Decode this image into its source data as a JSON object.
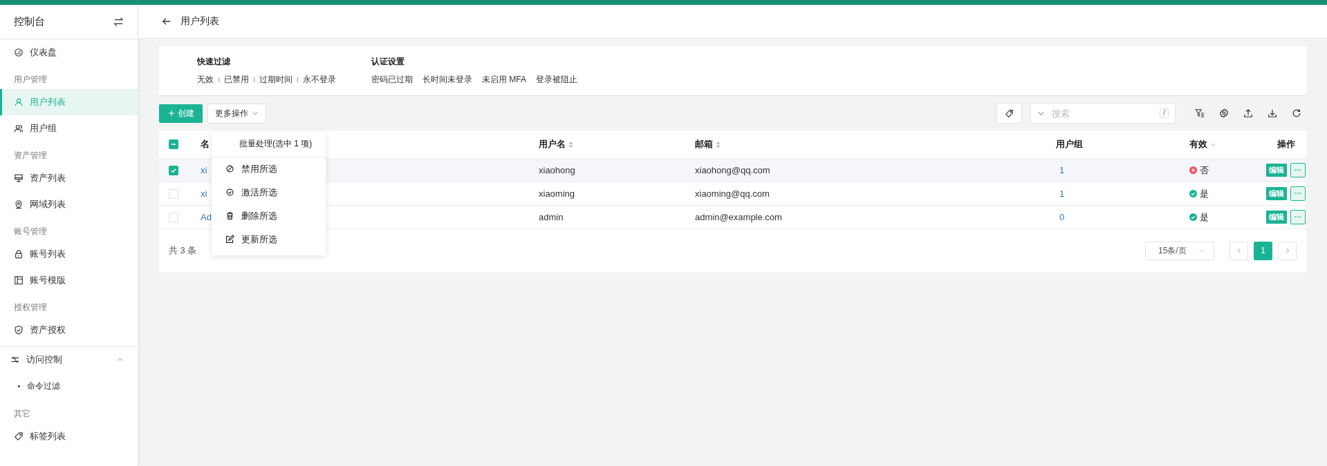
{
  "sidebar": {
    "title": "控制台",
    "items": [
      {
        "kind": "item",
        "label": "仪表盘",
        "selected": false
      },
      {
        "kind": "heading",
        "label": "用户管理"
      },
      {
        "kind": "item",
        "label": "用户列表",
        "selected": true
      },
      {
        "kind": "item",
        "label": "用户组",
        "selected": false
      },
      {
        "kind": "heading",
        "label": "资产管理"
      },
      {
        "kind": "item",
        "label": "资产列表",
        "selected": false
      },
      {
        "kind": "item",
        "label": "网域列表",
        "selected": false
      },
      {
        "kind": "heading",
        "label": "账号管理"
      },
      {
        "kind": "item",
        "label": "账号列表",
        "selected": false
      },
      {
        "kind": "item",
        "label": "账号模版",
        "selected": false
      },
      {
        "kind": "heading",
        "label": "授权管理"
      },
      {
        "kind": "item",
        "label": "资产授权",
        "selected": false
      },
      {
        "kind": "group",
        "label": "访问控制",
        "expanded": true,
        "children": [
          {
            "label": "命令过滤",
            "selected": false
          }
        ]
      },
      {
        "kind": "heading",
        "label": "其它"
      },
      {
        "kind": "item",
        "label": "标签列表",
        "selected": false
      }
    ]
  },
  "page": {
    "title": "用户列表"
  },
  "filters": [
    {
      "title": "快速过滤",
      "options": [
        "无效",
        "已禁用",
        "过期时间",
        "永不登录"
      ]
    },
    {
      "title": "认证设置",
      "options": [
        "密码已过期",
        "长时间未登录",
        "未启用 MFA",
        "登录被阻止"
      ]
    }
  ],
  "toolbar": {
    "create": "创建",
    "more": "更多操作",
    "search": {
      "placeholder": "搜索",
      "shortcut": "/"
    }
  },
  "bulk_menu": {
    "title": "批量处理(选中 1 项)",
    "items": [
      "禁用所选",
      "激活所选",
      "删除所选",
      "更新所选"
    ]
  },
  "table": {
    "select_all_partial": true,
    "columns": [
      {
        "label": "名",
        "kind": "plain"
      },
      {
        "label": "用户名",
        "kind": "sortable"
      },
      {
        "label": "邮箱",
        "kind": "sortable"
      },
      {
        "label": "用户组",
        "kind": "plain"
      },
      {
        "label": "有效",
        "kind": "filter"
      },
      {
        "label": "操作",
        "kind": "plain"
      }
    ],
    "rows": [
      {
        "selected": true,
        "name": "xi",
        "username": "xiaohong",
        "email": "xiaohong@qq.com",
        "groups": "1",
        "valid": false,
        "valid_text": "否",
        "edit": "编辑",
        "more": "···"
      },
      {
        "selected": false,
        "name": "xi",
        "username": "xiaoming",
        "email": "xiaoming@qq.com",
        "groups": "1",
        "valid": true,
        "valid_text": "是",
        "edit": "编辑",
        "more": "···"
      },
      {
        "selected": false,
        "name": "Ad",
        "username": "admin",
        "email": "admin@example.com",
        "groups": "0",
        "valid": true,
        "valid_text": "是",
        "edit": "编辑",
        "more": "···"
      }
    ]
  },
  "pagination": {
    "total": "共 3 条",
    "page_size": "15条/页",
    "pages": [
      {
        "label": "1",
        "selected": true
      }
    ]
  }
}
